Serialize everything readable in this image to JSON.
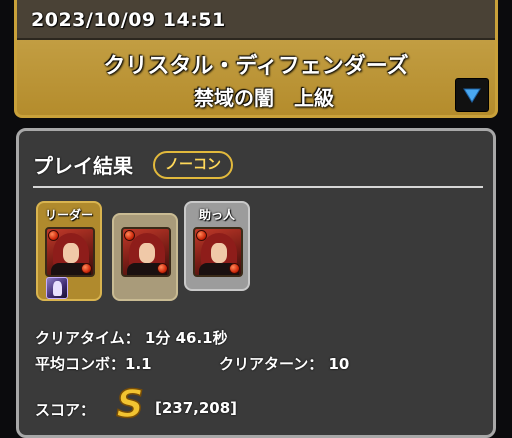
{
  "header": {
    "datetime": "2023/10/09 14:51",
    "dungeon_name": "クリスタル・ディフェンダーズ",
    "floor_name": "禁域の闇　上級",
    "dropdown_icon": "triangle-down-icon"
  },
  "result": {
    "title": "プレイ結果",
    "badge": "ノーコン",
    "team": {
      "leader_label": "リーダー",
      "helper_label": "助っ人"
    },
    "clear_time": "クリアタイム： 1分 46.1秒",
    "avg_combo": "平均コンボ：1.1",
    "clear_turns": "クリアターン： 10",
    "score_label": "スコア：",
    "score_rank": "S",
    "score_value": "[237,208]"
  },
  "colors": {
    "gold": "#c9a13a",
    "panel_bg": "#3a3a3a",
    "badge": "#e2b93c",
    "rank_gold": "#f2c431"
  }
}
